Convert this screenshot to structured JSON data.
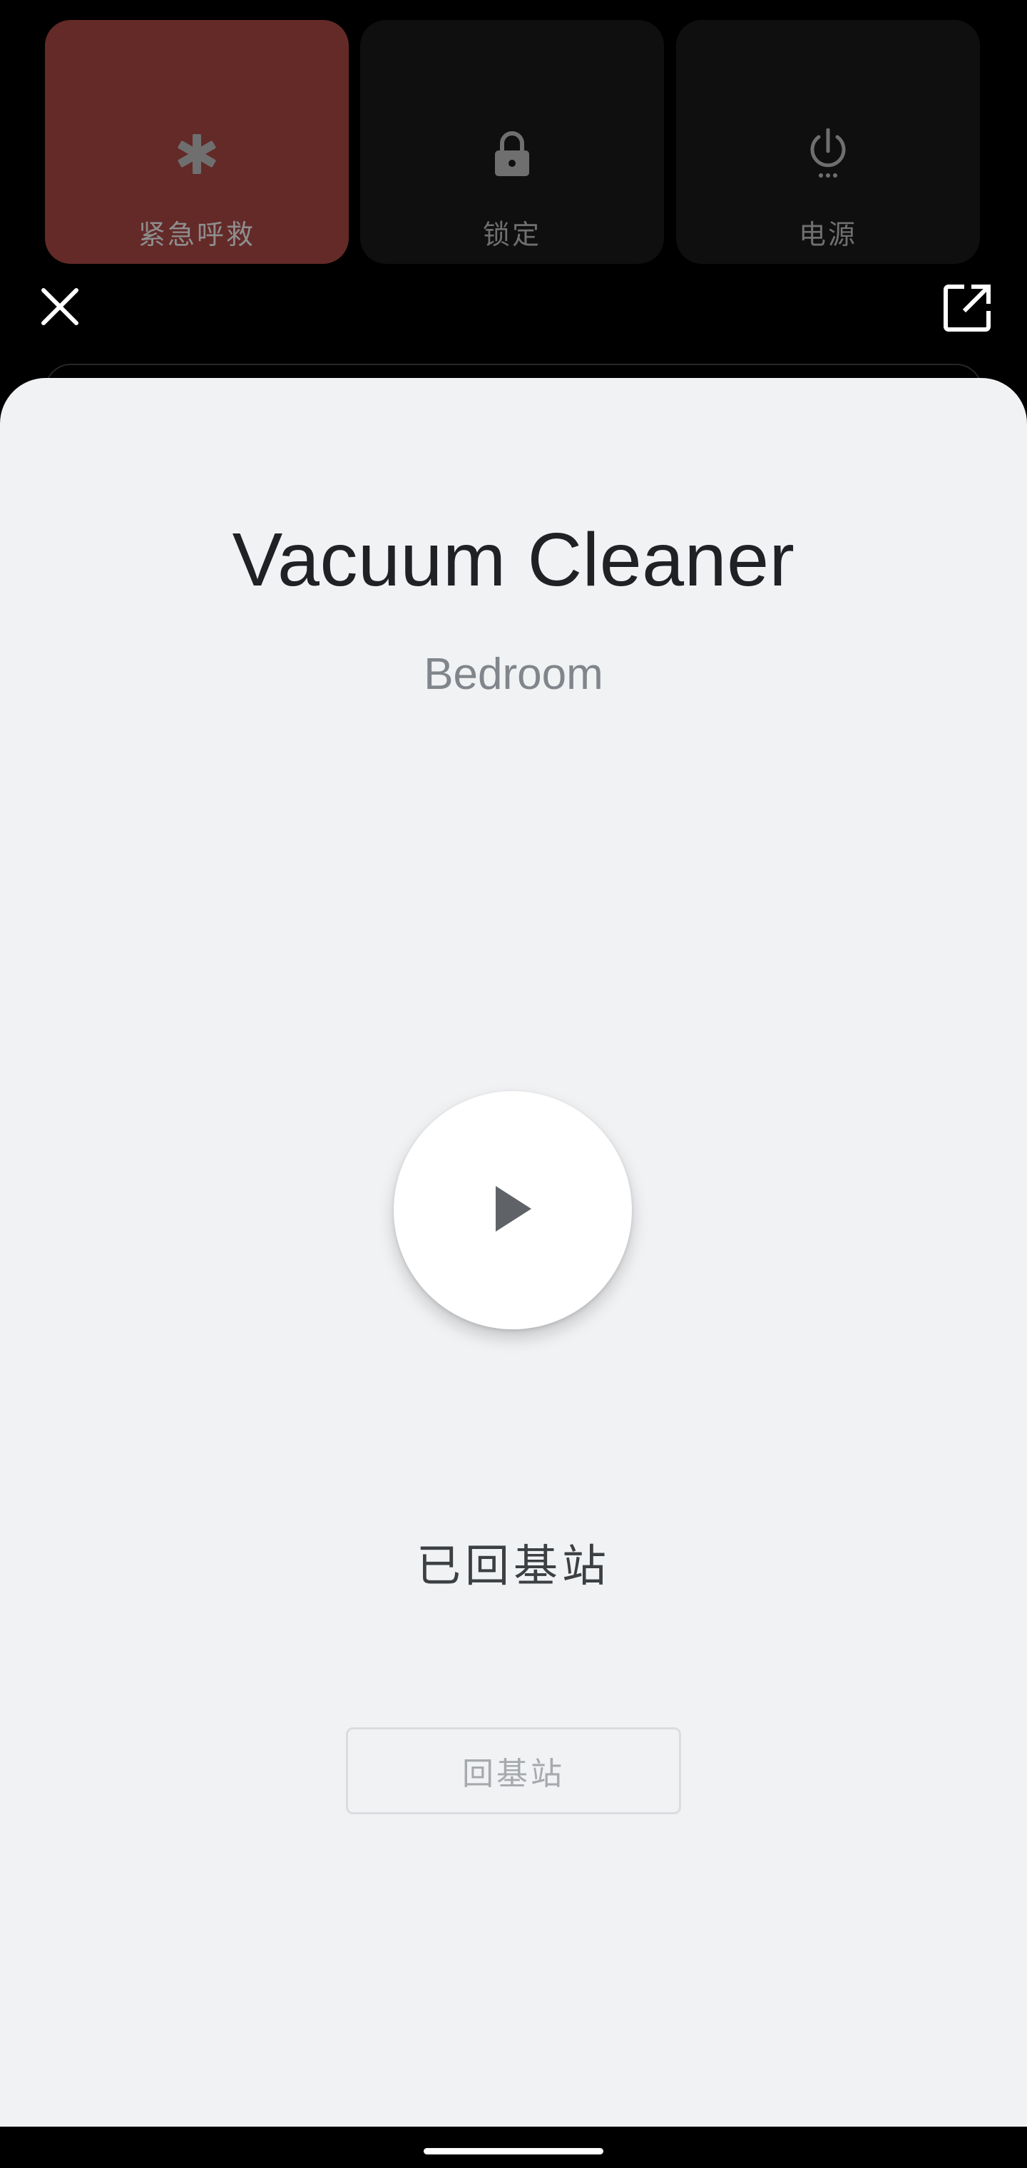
{
  "power_menu": {
    "tiles": [
      {
        "label": "紧急呼救",
        "icon": "medical-asterisk-icon",
        "color": "#632a28"
      },
      {
        "label": "锁定",
        "icon": "lock-icon",
        "color": "#0f0f0f"
      },
      {
        "label": "电源",
        "icon": "power-icon",
        "color": "#0f0f0f"
      }
    ]
  },
  "controls": {
    "close_icon": "close-icon",
    "open_icon": "open-in-new-icon"
  },
  "device_sheet": {
    "title": "Vacuum Cleaner",
    "subtitle": "Bedroom",
    "play_icon": "play-icon",
    "status": "已回基站",
    "dock_button_label": "回基站"
  },
  "colors": {
    "sheet_background": "#f1f2f4",
    "title": "#202124",
    "subtitle": "#80868b"
  }
}
